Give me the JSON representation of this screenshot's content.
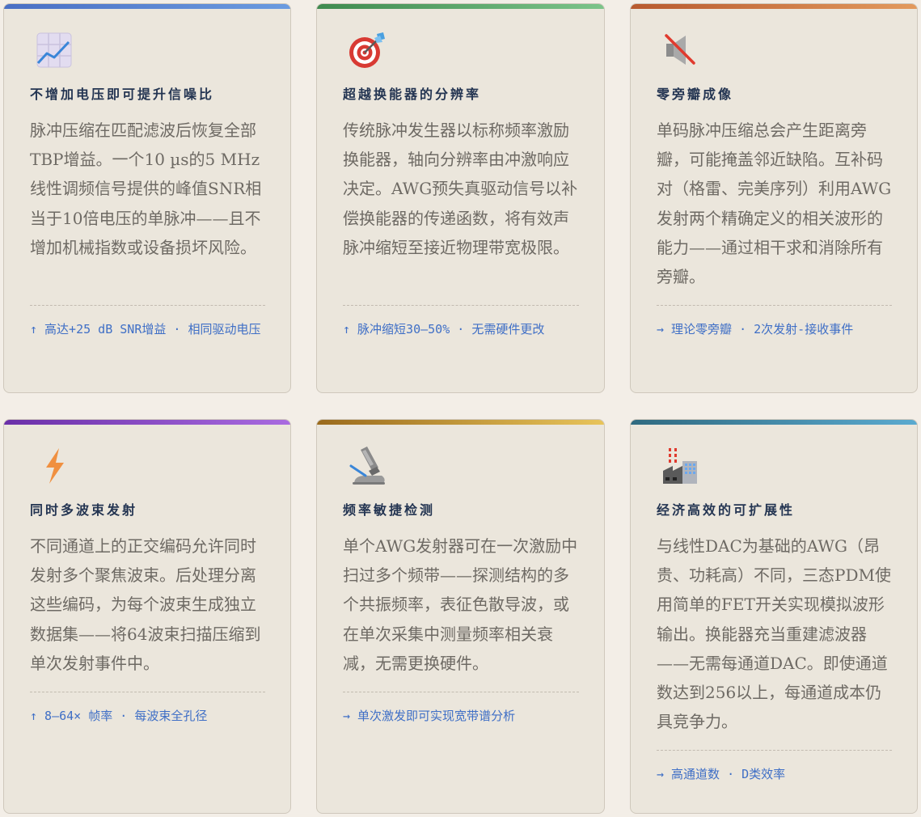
{
  "cards": [
    {
      "title": "不增加电压即可提升信噪比",
      "description": "脉冲压缩在匹配滤波后恢复全部TBP增益。一个10 µs的5 MHz线性调频信号提供的峰值SNR相当于10倍电压的单脉冲——且不增加机械指数或设备损坏风险。",
      "tagline": "↑ 高达+25 dB SNR增益 · 相同驱动电压",
      "icon": "chart-increasing-icon",
      "accent": [
        "#4a6fc4",
        "#6b9be0"
      ]
    },
    {
      "title": "超越换能器的分辨率",
      "description": "传统脉冲发生器以标称频率激励换能器，轴向分辨率由冲激响应决定。AWG预失真驱动信号以补偿换能器的传递函数，将有效声脉冲缩短至接近物理带宽极限。",
      "tagline": "↑ 脉冲缩短30–50% · 无需硬件更改",
      "icon": "target-icon",
      "accent": [
        "#3f8a4f",
        "#7cc48a"
      ]
    },
    {
      "title": "零旁瓣成像",
      "description": "单码脉冲压缩总会产生距离旁瓣，可能掩盖邻近缺陷。互补码对（格雷、完美序列）利用AWG发射两个精确定义的相关波形的能力——通过相干求和消除所有旁瓣。",
      "tagline": "→ 理论零旁瓣 · 2次发射-接收事件",
      "icon": "muted-speaker-icon",
      "accent": [
        "#b85a2e",
        "#e39a5e"
      ]
    },
    {
      "title": "同时多波束发射",
      "description": "不同通道上的正交编码允许同时发射多个聚焦波束。后处理分离这些编码，为每个波束生成独立数据集——将64波束扫描压缩到单次发射事件中。",
      "tagline": "↑ 8–64× 帧率 · 每波束全孔径",
      "icon": "lightning-icon",
      "accent": [
        "#6a2fa8",
        "#a96be0"
      ]
    },
    {
      "title": "频率敏捷检测",
      "description": "单个AWG发射器可在一次激励中扫过多个频带——探测结构的多个共振频率，表征色散导波，或在单次采集中测量频率相关衰减，无需更换硬件。",
      "tagline": "→ 单次激发即可实现宽带谱分析",
      "icon": "microscope-icon",
      "accent": [
        "#9a6a1c",
        "#e8c45a"
      ]
    },
    {
      "title": "经济高效的可扩展性",
      "description": "与线性DAC为基础的AWG（昂贵、功耗高）不同，三态PDM使用简单的FET开关实现模拟波形输出。换能器充当重建滤波器——无需每通道DAC。即使通道数达到256以上，每通道成本仍具竞争力。",
      "tagline": "→ 高通道数 · D类效率",
      "icon": "factory-icon",
      "accent": [
        "#2f6a80",
        "#5aaad0"
      ]
    }
  ]
}
